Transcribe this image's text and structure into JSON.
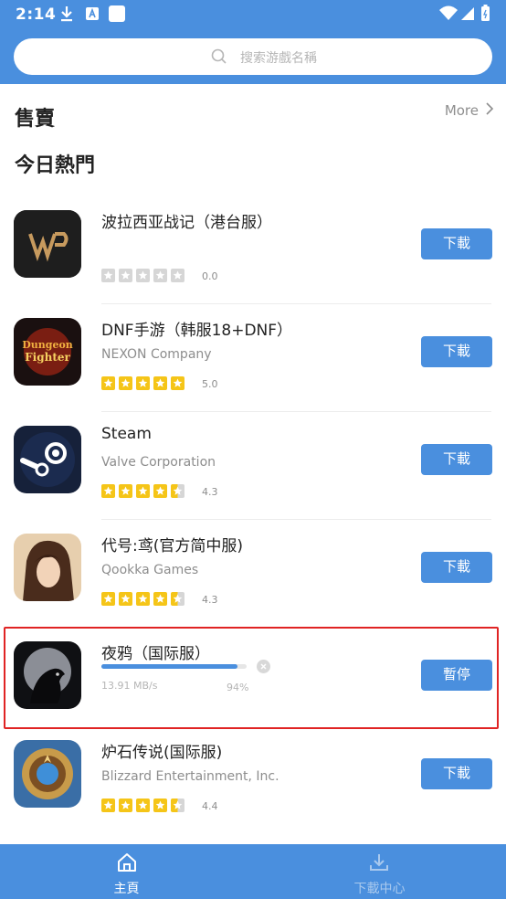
{
  "status_bar": {
    "time": "2:14"
  },
  "search": {
    "placeholder": "搜索游戲名稱"
  },
  "sections": {
    "sale_title": "售賣",
    "more_label": "More",
    "hot_title": "今日熱門"
  },
  "apps": [
    {
      "name": "波拉西亚战记（港台服）",
      "developer": "",
      "rating": 0.0,
      "rating_text": "0.0",
      "action_label": "下載"
    },
    {
      "name": "DNF手游（韩服18+DNF）",
      "developer": "NEXON Company",
      "rating": 5.0,
      "rating_text": "5.0",
      "action_label": "下載"
    },
    {
      "name": "Steam",
      "developer": "Valve Corporation",
      "rating": 4.3,
      "rating_text": "4.3",
      "action_label": "下載"
    },
    {
      "name": "代号:鸢(官方简中服)",
      "developer": "Qookka Games",
      "rating": 4.3,
      "rating_text": "4.3",
      "action_label": "下載"
    },
    {
      "name": "夜鸦（国际服）",
      "action_label": "暫停",
      "download_speed": "13.91 MB/s",
      "progress_text": "94%",
      "progress": 0.94
    },
    {
      "name": "炉石传说(国际服)",
      "developer": "Blizzard Entertainment, Inc.",
      "rating": 4.4,
      "rating_text": "4.4",
      "action_label": "下載"
    }
  ],
  "nav": {
    "home_label": "主頁",
    "downloads_label": "下載中心"
  },
  "colors": {
    "brand": "#4a8fde",
    "star": "#f5c518",
    "highlight": "#e02424"
  }
}
